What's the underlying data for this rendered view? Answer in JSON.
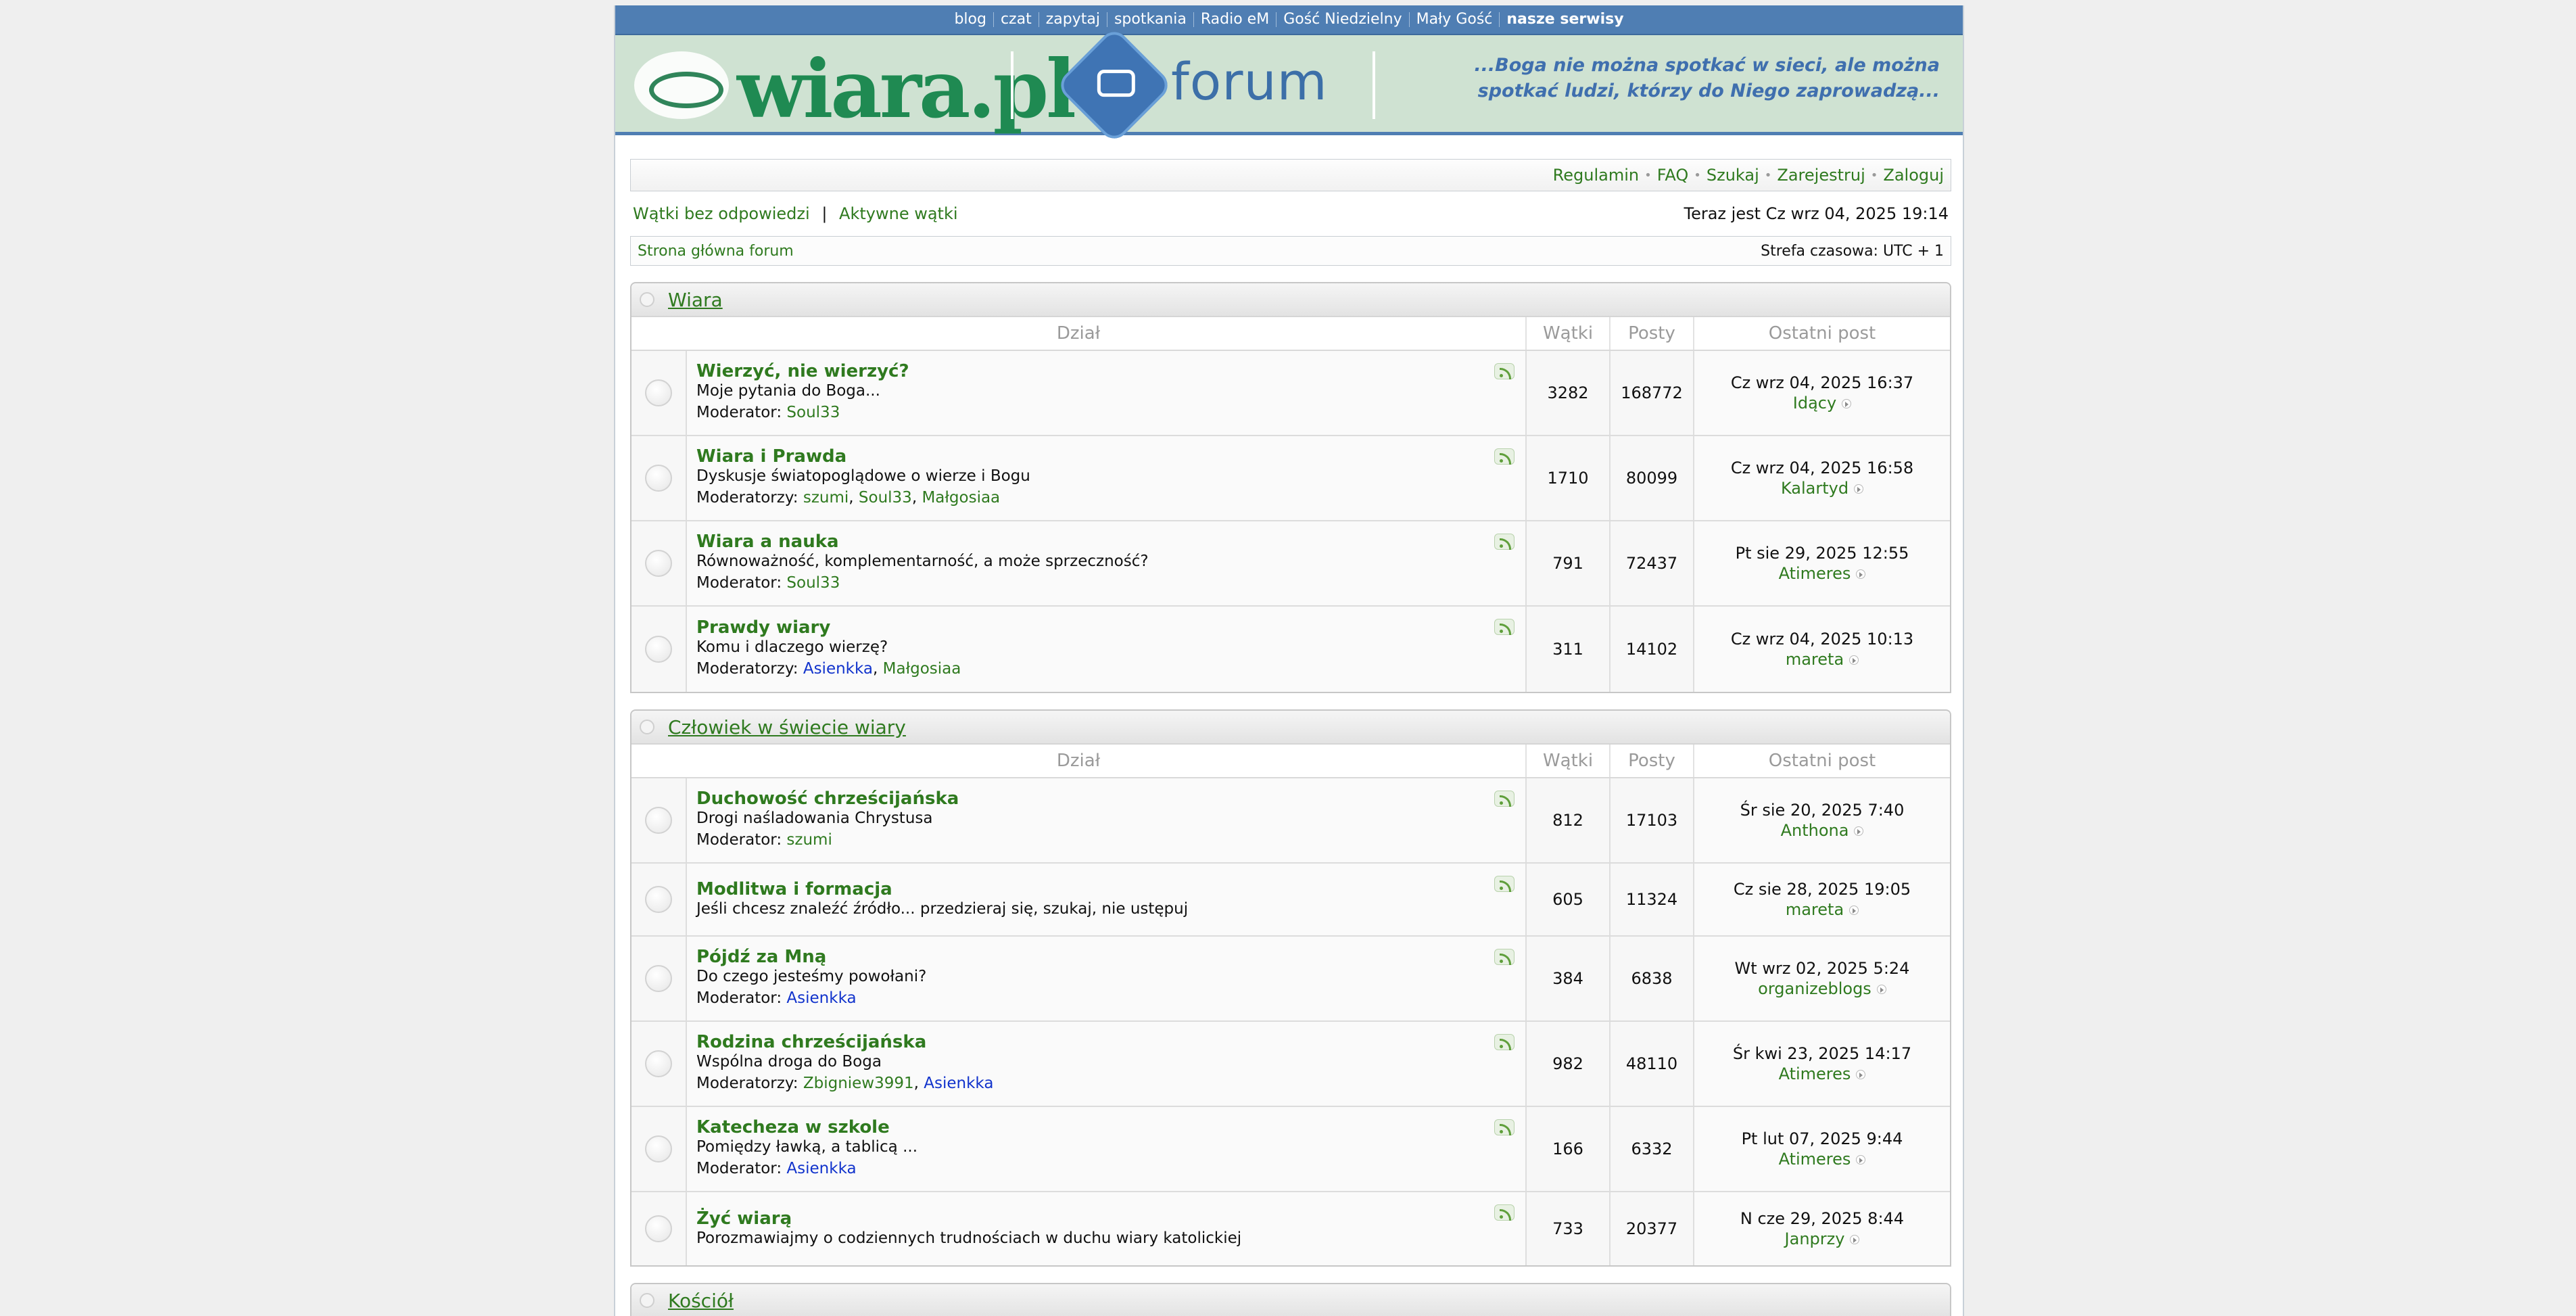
{
  "topnav": [
    "blog",
    "czat",
    "zapytaj",
    "spotkania",
    "Radio eM",
    "Gość Niedzielny",
    "Mały Gość",
    "nasze serwisy"
  ],
  "banner": {
    "logo": "wiara.pl",
    "forum": "forum",
    "tagline_line1": "...Boga nie można spotkać w sieci, ale można",
    "tagline_line2": "spotkać ludzi, którzy do Niego zaprowadzą..."
  },
  "navbar": [
    "Regulamin",
    "FAQ",
    "Szukaj",
    "Zarejestruj",
    "Zaloguj"
  ],
  "quick": {
    "unanswered": "Wątki bez odpowiedzi",
    "active": "Aktywne wątki",
    "sep": "|",
    "now": "Teraz jest Cz wrz 04, 2025 19:14"
  },
  "crumbs": {
    "home": "Strona główna forum",
    "tz": "Strefa czasowa: UTC + 1"
  },
  "columns": {
    "forum": "Dział",
    "topics": "Wątki",
    "posts": "Posty",
    "last": "Ostatni post"
  },
  "sections": [
    {
      "title": "Wiara",
      "rows": [
        {
          "name": "Wierzyć, nie wierzyć?",
          "desc": "Moje pytania do Boga...",
          "mod_label": "Moderator:",
          "mods": [
            {
              "n": "Soul33",
              "c": "green"
            }
          ],
          "topics": "3282",
          "posts": "168772",
          "last_date": "Cz wrz 04, 2025 16:37",
          "last_user": "Idący"
        },
        {
          "name": "Wiara i Prawda",
          "desc": "Dyskusje światopoglądowe o wierze i Bogu",
          "mod_label": "Moderatorzy:",
          "mods": [
            {
              "n": "szumi",
              "c": "green"
            },
            {
              "n": "Soul33",
              "c": "green"
            },
            {
              "n": "Małgosiaa",
              "c": "green"
            }
          ],
          "topics": "1710",
          "posts": "80099",
          "last_date": "Cz wrz 04, 2025 16:58",
          "last_user": "Kalartyd"
        },
        {
          "name": "Wiara a nauka",
          "desc": "Równoważność, komplementarność, a może sprzeczność?",
          "mod_label": "Moderator:",
          "mods": [
            {
              "n": "Soul33",
              "c": "green"
            }
          ],
          "topics": "791",
          "posts": "72437",
          "last_date": "Pt sie 29, 2025 12:55",
          "last_user": "Atimeres"
        },
        {
          "name": "Prawdy wiary",
          "desc": "Komu i dlaczego wierzę?",
          "mod_label": "Moderatorzy:",
          "mods": [
            {
              "n": "Asienkka",
              "c": "blue"
            },
            {
              "n": "Małgosiaa",
              "c": "green"
            }
          ],
          "topics": "311",
          "posts": "14102",
          "last_date": "Cz wrz 04, 2025 10:13",
          "last_user": "mareta"
        }
      ]
    },
    {
      "title": "Człowiek w świecie wiary",
      "rows": [
        {
          "name": "Duchowość chrześcijańska",
          "desc": "Drogi naśladowania Chrystusa",
          "mod_label": "Moderator:",
          "mods": [
            {
              "n": "szumi",
              "c": "green"
            }
          ],
          "topics": "812",
          "posts": "17103",
          "last_date": "Śr sie 20, 2025 7:40",
          "last_user": "Anthona"
        },
        {
          "name": "Modlitwa i formacja",
          "desc": "Jeśli chcesz znaleźć źródło... przedzieraj się, szukaj, nie ustępuj",
          "mod_label": "",
          "mods": [],
          "topics": "605",
          "posts": "11324",
          "last_date": "Cz sie 28, 2025 19:05",
          "last_user": "mareta"
        },
        {
          "name": "Pójdź za Mną",
          "desc": "Do czego jesteśmy powołani?",
          "mod_label": "Moderator:",
          "mods": [
            {
              "n": "Asienkka",
              "c": "blue"
            }
          ],
          "topics": "384",
          "posts": "6838",
          "last_date": "Wt wrz 02, 2025 5:24",
          "last_user": "organizeblogs"
        },
        {
          "name": "Rodzina chrześcijańska",
          "desc": "Wspólna droga do Boga",
          "mod_label": "Moderatorzy:",
          "mods": [
            {
              "n": "Zbigniew3991",
              "c": "green"
            },
            {
              "n": "Asienkka",
              "c": "blue"
            }
          ],
          "topics": "982",
          "posts": "48110",
          "last_date": "Śr kwi 23, 2025 14:17",
          "last_user": "Atimeres"
        },
        {
          "name": "Katecheza w szkole",
          "desc": "Pomiędzy ławką, a tablicą ...",
          "mod_label": "Moderator:",
          "mods": [
            {
              "n": "Asienkka",
              "c": "blue"
            }
          ],
          "topics": "166",
          "posts": "6332",
          "last_date": "Pt lut 07, 2025 9:44",
          "last_user": "Atimeres"
        },
        {
          "name": "Żyć wiarą",
          "desc": "Porozmawiajmy o codziennych trudnościach w duchu wiary katolickiej",
          "mod_label": "",
          "mods": [],
          "topics": "733",
          "posts": "20377",
          "last_date": "N cze 29, 2025 8:44",
          "last_user": "Janprzy"
        }
      ]
    },
    {
      "title": "Kościół",
      "rows": []
    }
  ]
}
